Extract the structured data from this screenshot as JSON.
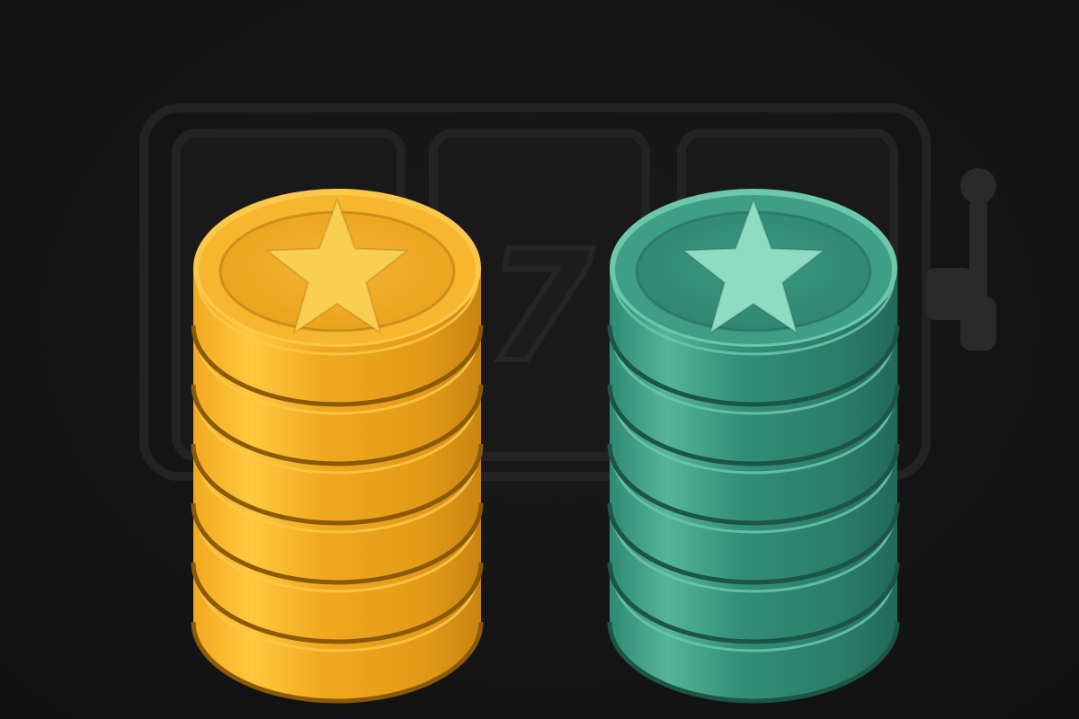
{
  "background": {
    "color": "#141415",
    "slot_machine": {
      "reel_symbol": "7",
      "outline_color": "#232324",
      "reel_count": 3,
      "has_lever": true
    }
  },
  "stacks": [
    {
      "name": "gold-coin-stack",
      "color_top": "#f6b62e",
      "color_face": "#e9a21c",
      "color_rim_light": "#fbc84a",
      "color_rim_dark": "#8a5a0a",
      "star_color": "#f9cf52",
      "coin_count": 6,
      "top_icon": "star-icon"
    },
    {
      "name": "green-chip-stack",
      "color_top": "#3f9f86",
      "color_face": "#2f8a72",
      "color_rim_light": "#6cc7ab",
      "color_rim_dark": "#1c5446",
      "star_color": "#8fdcc2",
      "coin_count": 6,
      "top_icon": "star-icon"
    }
  ]
}
